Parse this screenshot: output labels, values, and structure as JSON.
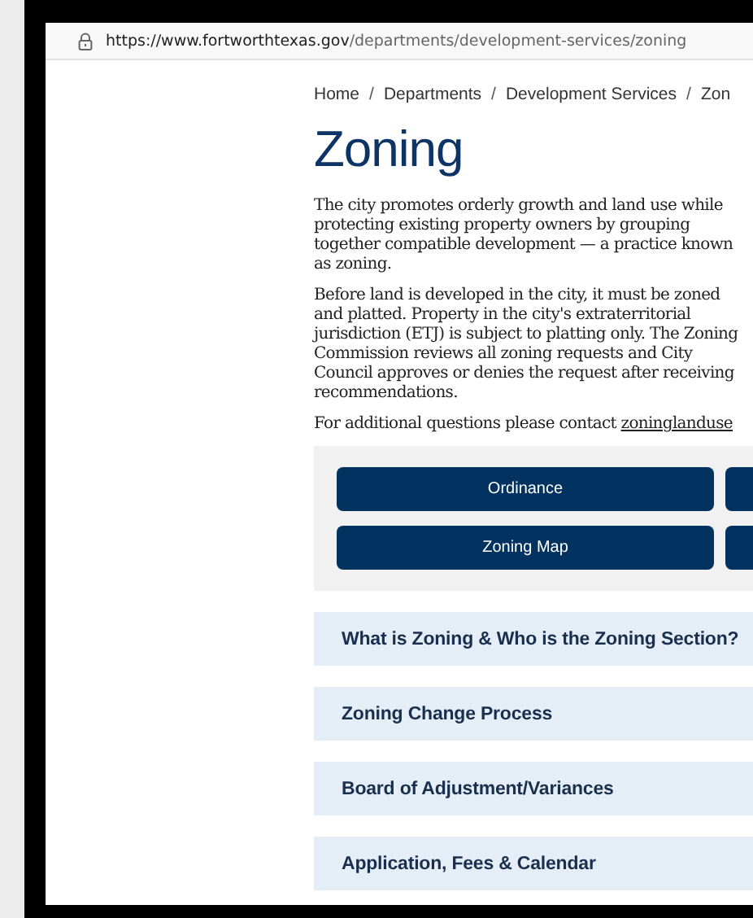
{
  "browser": {
    "url_host": "https://www.fortworthtexas.gov",
    "url_path": "/departments/development-services/zoning"
  },
  "breadcrumb": [
    "Home",
    "Departments",
    "Development Services",
    "Zon"
  ],
  "breadcrumb_separator": "/",
  "title": "Zoning",
  "paragraphs": [
    {
      "lines": [
        "The city promotes orderly growth and land use while",
        "protecting existing property owners by grouping",
        "together compatible development — a practice known",
        "as zoning."
      ]
    },
    {
      "lines": [
        "Before land is developed in the city, it must be zoned",
        "and platted. Property in the city's extraterritorial",
        "jurisdiction (ETJ) is subject to platting only. The Zoning",
        "Commission reviews all zoning requests and City",
        "Council approves or denies the request after receiving",
        "recommendations."
      ]
    }
  ],
  "contact": {
    "text": "For additional questions please contact",
    "link": "zoninglanduse"
  },
  "buttons": [
    {
      "kind": "labeled",
      "label": "Ordinance"
    },
    {
      "kind": "cut"
    },
    {
      "kind": "labeled",
      "label": "Zoning Map"
    },
    {
      "kind": "cut"
    }
  ],
  "accordion": [
    {
      "title": "What is Zoning & Who is the Zoning Section?",
      "expanded": false
    },
    {
      "title": "Zoning Change Process",
      "expanded": false
    },
    {
      "title": "Board of Adjustment/Variances",
      "expanded": false
    },
    {
      "title": "Application, Fees & Calendar",
      "expanded": false
    }
  ]
}
